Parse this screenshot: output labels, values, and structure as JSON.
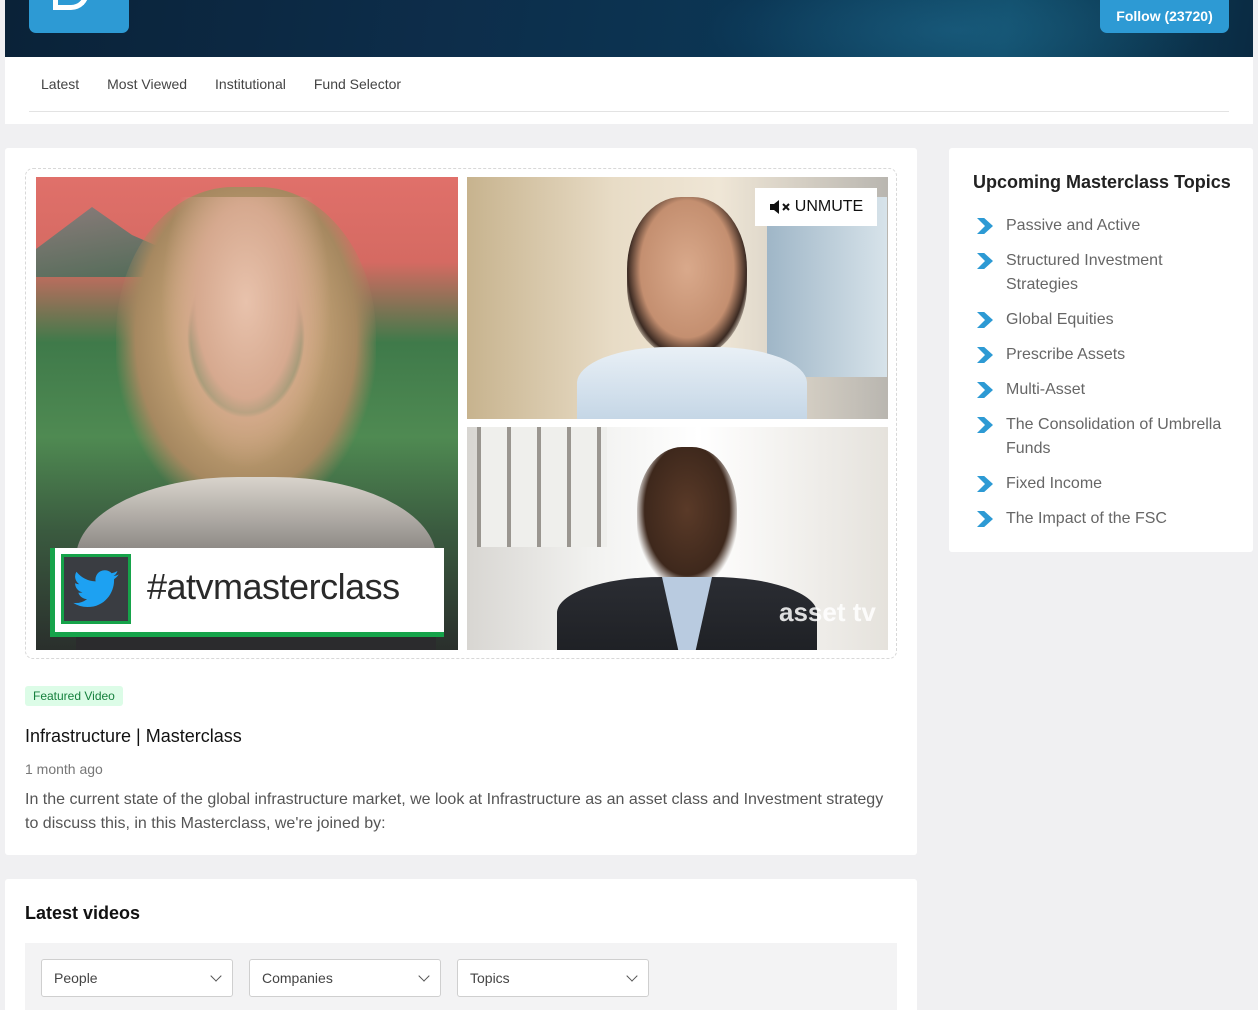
{
  "header": {
    "follow_label": "Follow (23720)",
    "nav": [
      "Latest",
      "Most Viewed",
      "Institutional",
      "Fund Selector"
    ]
  },
  "featured": {
    "unmute_label": "UNMUTE",
    "hashtag": "#atvmasterclass",
    "watermark": "asset tv",
    "badge": "Featured Video",
    "title": "Infrastructure | Masterclass",
    "time_ago": "1 month ago",
    "description": "In the current state of the global infrastructure market, we look at Infrastructure as an asset class and Investment strategy to discuss this, in this Masterclass, we're joined by:"
  },
  "sidebar": {
    "title": "Upcoming Masterclass Topics",
    "topics": [
      "Passive and Active",
      "Structured Investment Strategies",
      "Global Equities",
      "Prescribe Assets",
      "Multi-Asset",
      "The Consolidation of Umbrella Funds",
      "Fixed Income",
      "The Impact of the FSC"
    ]
  },
  "latest": {
    "title": "Latest videos",
    "filters": [
      "People",
      "Companies",
      "Topics"
    ]
  },
  "colors": {
    "accent": "#2d9ad4",
    "badge_bg": "#dcfce7",
    "badge_text": "#15803d"
  }
}
